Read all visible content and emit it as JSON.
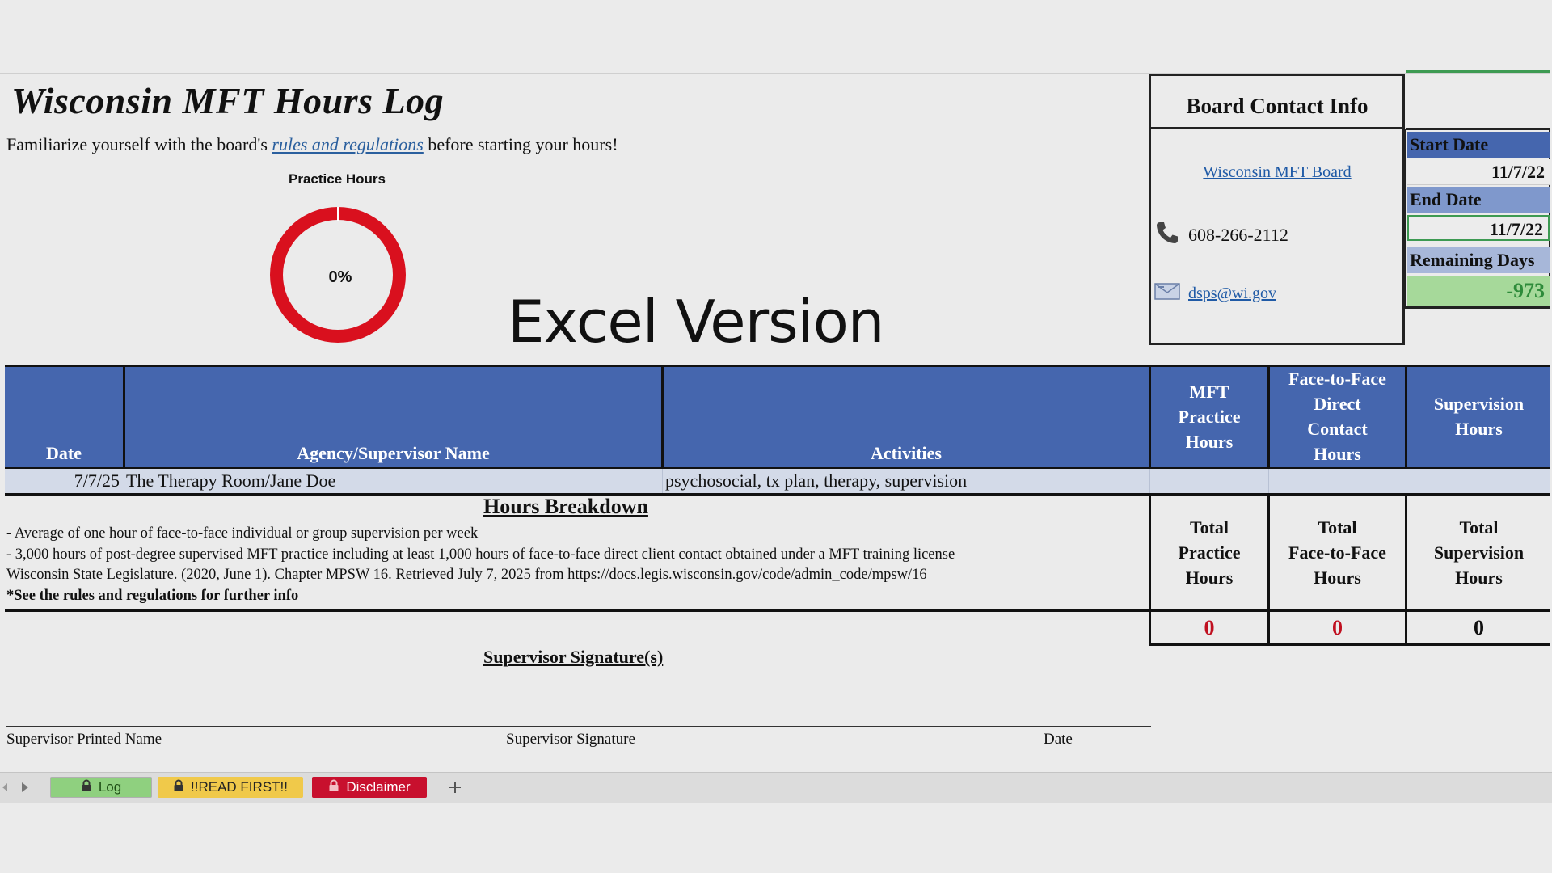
{
  "header": {
    "title": "Wisconsin MFT Hours Log",
    "intro_before": "Familiarize yourself with the board's ",
    "intro_link": "rules and regulations",
    "intro_after": " before starting your hours!"
  },
  "progress": {
    "title": "Practice Hours",
    "label": "0%",
    "value_percent": 0,
    "color": "#d9101e"
  },
  "watermark": "Excel Version",
  "contact": {
    "title": "Board Contact Info",
    "board_link": "Wisconsin MFT Board",
    "phone": "608-266-2112",
    "email": "dsps@wi.gov"
  },
  "dates": {
    "start_label": "Start Date",
    "start_value": "11/7/22",
    "end_label": "End Date",
    "end_value": "11/7/22",
    "remaining_label": "Remaining Days",
    "remaining_value": "-973"
  },
  "table": {
    "headers": {
      "date": "Date",
      "agency": "Agency/Supervisor Name",
      "activities": "Activities",
      "mft_1": "MFT",
      "mft_2": "Practice",
      "mft_3": "Hours",
      "f2f_1": "Face-to-Face",
      "f2f_2": "Direct",
      "f2f_3": "Contact",
      "f2f_4": "Hours",
      "sup_1": "Supervision",
      "sup_2": "Hours"
    },
    "rows": [
      {
        "date": "7/7/25",
        "agency": "The Therapy Room/Jane Doe",
        "activities": "psychosocial, tx plan, therapy, supervision",
        "mft": "",
        "f2f": "",
        "sup": ""
      }
    ]
  },
  "breakdown": {
    "title": "Hours Breakdown",
    "line1": "- Average of one hour of face-to-face individual or group supervision per week",
    "line2": "- 3,000 hours of post-degree supervised MFT practice including at least 1,000 hours of face-to-face direct client contact obtained under a MFT training license",
    "line3": "Wisconsin State Legislature. (2020, June 1). Chapter MPSW 16. Retrieved July 7, 2025 from https://docs.legis.wisconsin.gov/code/admin_code/mpsw/16",
    "line4": "*See the rules and regulations for further info"
  },
  "totals": {
    "practice_1": "Total",
    "practice_2": "Practice",
    "practice_3": "Hours",
    "f2f_1": "Total",
    "f2f_2": "Face-to-Face",
    "f2f_3": "Hours",
    "sup_1": "Total",
    "sup_2": "Supervision",
    "sup_3": "Hours",
    "practice_value": "0",
    "f2f_value": "0",
    "sup_value": "0"
  },
  "signatures": {
    "title": "Supervisor Signature(s)",
    "printed_name": "Supervisor Printed Name",
    "signature": "Supervisor Signature",
    "date": "Date"
  },
  "tabs": [
    {
      "label": "Log",
      "color": "#8fd07f",
      "text_color": "#1d4d14"
    },
    {
      "label": "!!READ FIRST!!",
      "color": "#f0c94a",
      "text_color": "#222222"
    },
    {
      "label": "Disclaimer",
      "color": "#c8102e",
      "text_color": "#ffffff"
    }
  ],
  "colors": {
    "header_blue": "#4566ae",
    "remaining_bg": "#a6d99a",
    "remaining_text": "#2e8b3a",
    "total_red": "#c01020"
  }
}
